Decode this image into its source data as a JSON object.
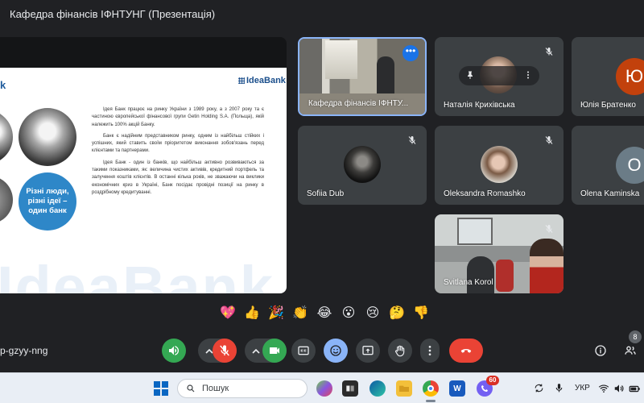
{
  "window": {
    "title": "Кафедра фінансів ІФНТУНГ (Презентація)"
  },
  "slide": {
    "heading": "k",
    "logo": "IdeaBank",
    "watermark": "IdeaBank",
    "bubble_text": "Різні люди, різні ідеї – один банк",
    "paragraphs": [
      "Ідея Банк працює на ринку України з 1989 року, а з 2007 року та є частиною європейської фінансової групи Getin Holding S.A. (Польща), якій належить 100% акцій Банку.",
      "Банк є надійним представником ринку, одним із найбільш стійких і успішних, який ставить своїм пріоритетом виконання зобов'язань перед клієнтами та партнерами.",
      "Ідея Банк - один із банків, що найбільш активно розвиваються за такими показниками, як: величина чистих активів, кредитний портфель та залучення коштів клієнтів. В останні кілька років, не зважаючи на виклики економічних криз в Україні, Банк посідає провідні позиції на ринку в роздрібному кредитуванні."
    ]
  },
  "participants": {
    "presenter": {
      "name": "Кафедра фінансів ІФНТУ...",
      "more_icon": "more-dots-icon"
    },
    "natalia": {
      "name": "Наталія Крихівська",
      "pin_icon": "pin-icon",
      "more_icon": "more-vert-icon"
    },
    "yulia": {
      "name": "Юлія Братенко",
      "letter": "Ю"
    },
    "sofiia": {
      "name": "Sofiia Dub"
    },
    "oleksandra": {
      "name": "Oleksandra Romashko"
    },
    "olena": {
      "name": "Olena Kaminska",
      "letter": "O"
    },
    "svitlana": {
      "name": "Svitlana Korol"
    }
  },
  "reactions": [
    "💖",
    "👍",
    "🎉",
    "👏",
    "😂",
    "😮",
    "😢",
    "🤔",
    "👎"
  ],
  "call_bar": {
    "meeting_code": "p-gzyy-nng",
    "people_count": "8",
    "colors": {
      "leave": "#ea4335",
      "mic_off": "#ea4335",
      "camera_on": "#34a853",
      "emoji_active": "#8ab4f8"
    }
  },
  "taskbar": {
    "search_placeholder": "Пошук",
    "viber_badge": "60",
    "language": "УКР"
  }
}
